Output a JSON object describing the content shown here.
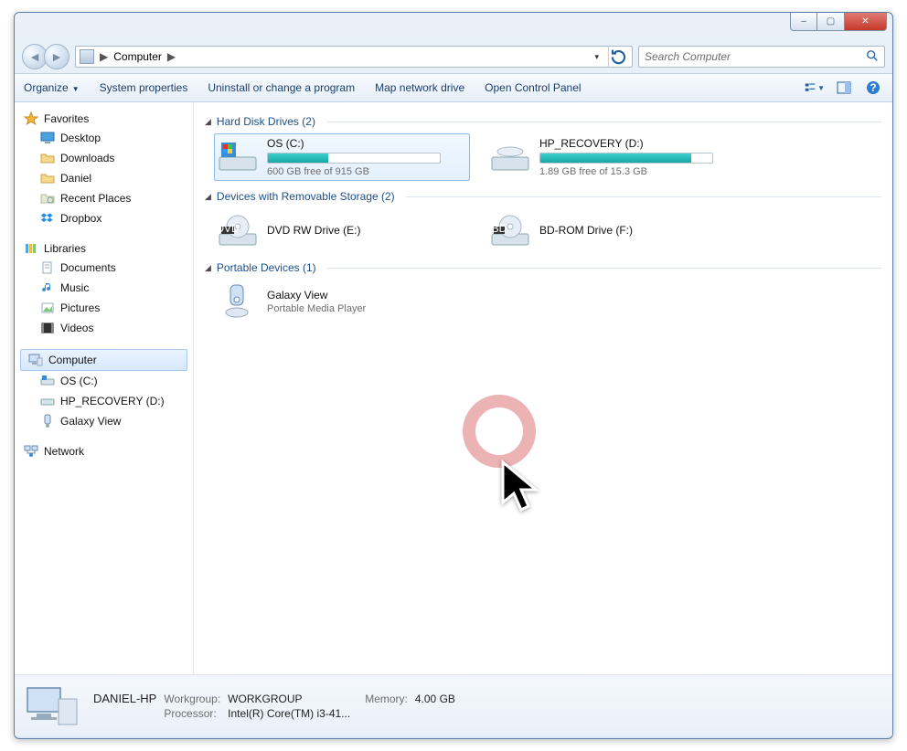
{
  "titlebar": {
    "minimize": "–",
    "maximize": "▢",
    "close": "✕"
  },
  "address": {
    "location": "Computer",
    "sep": "▶",
    "dropdown": "▾",
    "refresh": "↻"
  },
  "search": {
    "placeholder": "Search Computer"
  },
  "toolbar": {
    "organize": "Organize",
    "system_properties": "System properties",
    "uninstall": "Uninstall or change a program",
    "map_drive": "Map network drive",
    "control_panel": "Open Control Panel"
  },
  "sidebar": {
    "favorites": {
      "label": "Favorites"
    },
    "favorites_items": [
      {
        "label": "Desktop"
      },
      {
        "label": "Downloads"
      },
      {
        "label": "Daniel"
      },
      {
        "label": "Recent Places"
      },
      {
        "label": "Dropbox"
      }
    ],
    "libraries": {
      "label": "Libraries"
    },
    "libraries_items": [
      {
        "label": "Documents"
      },
      {
        "label": "Music"
      },
      {
        "label": "Pictures"
      },
      {
        "label": "Videos"
      }
    ],
    "computer": {
      "label": "Computer"
    },
    "computer_items": [
      {
        "label": "OS (C:)"
      },
      {
        "label": "HP_RECOVERY (D:)"
      },
      {
        "label": "Galaxy View"
      }
    ],
    "network": {
      "label": "Network"
    }
  },
  "groups": {
    "hdd": {
      "title": "Hard Disk Drives (2)"
    },
    "removable": {
      "title": "Devices with Removable Storage (2)"
    },
    "portable": {
      "title": "Portable Devices (1)"
    }
  },
  "drives": {
    "os": {
      "title": "OS (C:)",
      "subtitle": "600 GB free of 915 GB",
      "fill_pct": 35
    },
    "hprec": {
      "title": "HP_RECOVERY (D:)",
      "subtitle": "1.89 GB free of 15.3 GB",
      "fill_pct": 88
    },
    "dvd": {
      "title": "DVD RW Drive (E:)"
    },
    "bd": {
      "title": "BD-ROM Drive (F:)"
    },
    "galaxy": {
      "title": "Galaxy View",
      "subtitle": "Portable Media Player"
    }
  },
  "details": {
    "name": "DANIEL-HP",
    "workgroup_label": "Workgroup:",
    "workgroup": "WORKGROUP",
    "memory_label": "Memory:",
    "memory": "4.00 GB",
    "processor_label": "Processor:",
    "processor": "Intel(R) Core(TM) i3-41..."
  }
}
